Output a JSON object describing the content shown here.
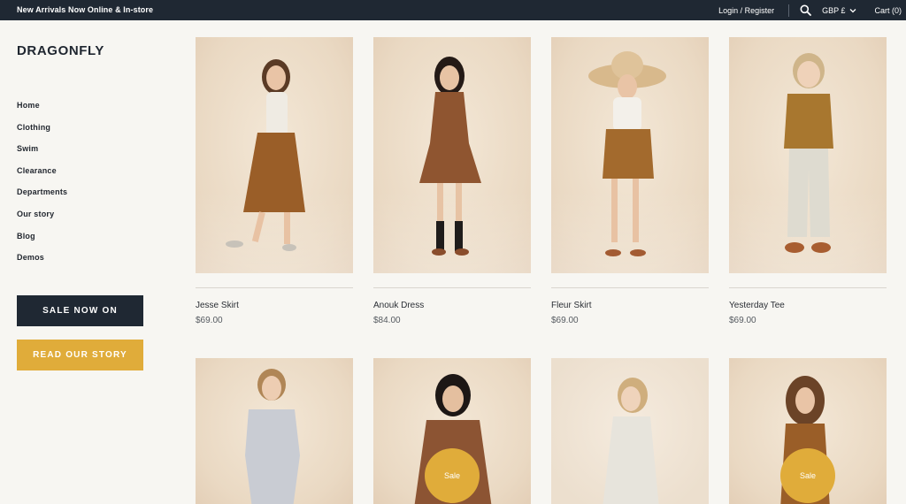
{
  "announcement": "New Arrivals Now Online & In-store",
  "header": {
    "login": "Login / Register",
    "currency": "GBP £",
    "cart": "Cart (0)"
  },
  "brand": "DRAGONFLY",
  "nav": [
    "Home",
    "Clothing",
    "Swim",
    "Clearance",
    "Departments",
    "Our story",
    "Blog",
    "Demos"
  ],
  "buttons": {
    "sale": "SALE NOW ON",
    "story": "READ OUR STORY"
  },
  "products_row1": [
    {
      "name": "Jesse Skirt",
      "price": "$69.00"
    },
    {
      "name": "Anouk Dress",
      "price": "$84.00"
    },
    {
      "name": "Fleur Skirt",
      "price": "$69.00"
    },
    {
      "name": "Yesterday Tee",
      "price": "$69.00"
    }
  ],
  "sale_badge": "Sale",
  "colors": {
    "dark": "#1f2833",
    "gold": "#e0ac3a",
    "background": "#f7f6f2"
  }
}
